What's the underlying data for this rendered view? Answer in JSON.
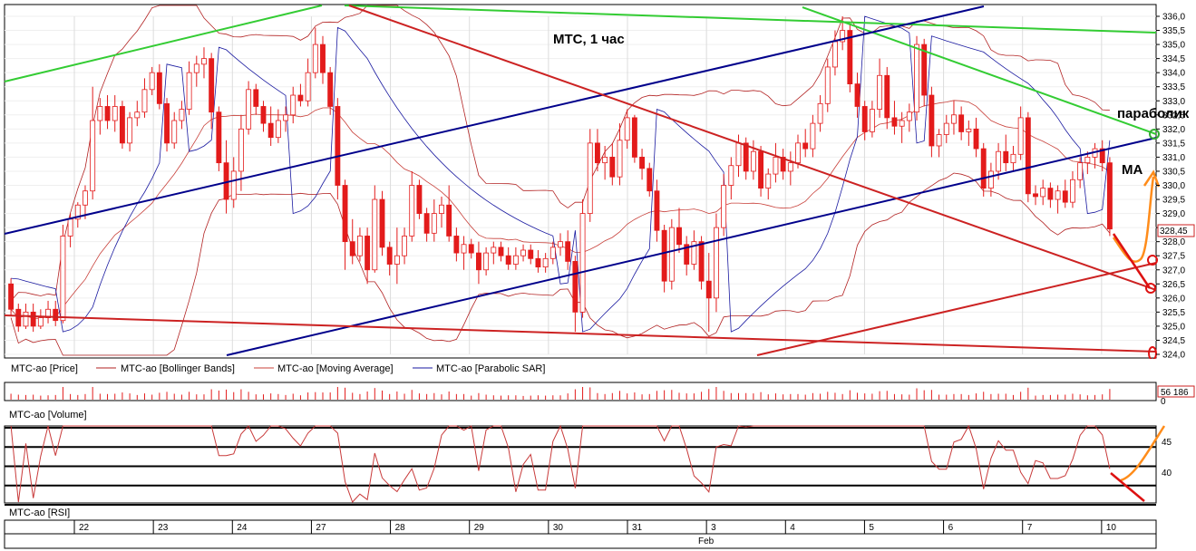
{
  "chart_data": [
    {
      "type": "candlestick",
      "title": "МТС,   1 час",
      "ylim": [
        324.0,
        336.0
      ],
      "ticks": [
        "336,0",
        "335,5",
        "335,0",
        "334,5",
        "334,0",
        "333,5",
        "333,0",
        "332,5",
        "332,0",
        "331,5",
        "331,0",
        "330,5",
        "330,0",
        "329,5",
        "329,0",
        "328,5",
        "328,0",
        "327,5",
        "327,0",
        "326,5",
        "326,0",
        "325,5",
        "325,0",
        "324,5",
        "324,0"
      ],
      "last_price_label": "328,45",
      "last_price": 328.45,
      "legend": [
        "MTC-ao [Price]",
        "MTC-ao [Bollinger Bands]",
        "MTC-ao [Moving Average]",
        "MTC-ao [Parabolic SAR]"
      ],
      "annotations": [
        "параболик",
        "MA"
      ],
      "candles": [
        {
          "o": 326.5,
          "h": 326.7,
          "l": 325.4,
          "c": 325.6
        },
        {
          "o": 325.6,
          "h": 325.8,
          "l": 324.8,
          "c": 325.0
        },
        {
          "o": 325.0,
          "h": 325.8,
          "l": 324.9,
          "c": 325.5
        },
        {
          "o": 325.5,
          "h": 325.8,
          "l": 324.8,
          "c": 325.0
        },
        {
          "o": 325.0,
          "h": 325.6,
          "l": 324.9,
          "c": 325.3
        },
        {
          "o": 325.3,
          "h": 325.9,
          "l": 325.1,
          "c": 325.6
        },
        {
          "o": 325.6,
          "h": 325.9,
          "l": 325.0,
          "c": 325.2
        },
        {
          "o": 325.2,
          "h": 328.6,
          "l": 325.1,
          "c": 328.2
        },
        {
          "o": 328.2,
          "h": 329.0,
          "l": 327.8,
          "c": 328.8
        },
        {
          "o": 328.8,
          "h": 329.4,
          "l": 328.5,
          "c": 329.3
        },
        {
          "o": 329.3,
          "h": 330.0,
          "l": 328.8,
          "c": 329.8
        },
        {
          "o": 329.8,
          "h": 333.5,
          "l": 329.5,
          "c": 332.3
        },
        {
          "o": 332.3,
          "h": 333.1,
          "l": 331.8,
          "c": 332.8
        },
        {
          "o": 332.8,
          "h": 333.2,
          "l": 332.0,
          "c": 332.3
        },
        {
          "o": 332.3,
          "h": 333.2,
          "l": 331.9,
          "c": 332.8
        },
        {
          "o": 332.8,
          "h": 333.0,
          "l": 331.3,
          "c": 331.5
        },
        {
          "o": 331.5,
          "h": 332.6,
          "l": 331.2,
          "c": 332.4
        },
        {
          "o": 332.4,
          "h": 333.0,
          "l": 332.1,
          "c": 332.6
        },
        {
          "o": 332.6,
          "h": 333.8,
          "l": 332.4,
          "c": 333.4
        },
        {
          "o": 333.4,
          "h": 334.2,
          "l": 333.2,
          "c": 334.0
        },
        {
          "o": 334.0,
          "h": 334.3,
          "l": 332.7,
          "c": 332.9
        },
        {
          "o": 332.9,
          "h": 333.1,
          "l": 331.2,
          "c": 331.5
        },
        {
          "o": 331.5,
          "h": 332.6,
          "l": 331.3,
          "c": 332.3
        },
        {
          "o": 332.3,
          "h": 333.0,
          "l": 332.0,
          "c": 332.7
        },
        {
          "o": 332.7,
          "h": 334.4,
          "l": 332.5,
          "c": 334.0
        },
        {
          "o": 334.0,
          "h": 334.6,
          "l": 333.5,
          "c": 334.3
        },
        {
          "o": 334.3,
          "h": 334.9,
          "l": 333.8,
          "c": 334.5
        },
        {
          "o": 334.5,
          "h": 334.7,
          "l": 332.0,
          "c": 332.6
        },
        {
          "o": 332.6,
          "h": 332.8,
          "l": 330.5,
          "c": 330.8
        },
        {
          "o": 330.8,
          "h": 331.6,
          "l": 329.0,
          "c": 329.5
        },
        {
          "o": 329.5,
          "h": 331.0,
          "l": 329.2,
          "c": 330.5
        },
        {
          "o": 330.5,
          "h": 332.5,
          "l": 329.8,
          "c": 332.0
        },
        {
          "o": 332.0,
          "h": 333.7,
          "l": 331.8,
          "c": 333.4
        },
        {
          "o": 333.4,
          "h": 333.6,
          "l": 332.5,
          "c": 332.8
        },
        {
          "o": 332.8,
          "h": 333.0,
          "l": 331.9,
          "c": 332.2
        },
        {
          "o": 332.2,
          "h": 332.8,
          "l": 331.4,
          "c": 331.7
        },
        {
          "o": 331.7,
          "h": 332.7,
          "l": 331.5,
          "c": 332.3
        },
        {
          "o": 332.3,
          "h": 332.8,
          "l": 331.9,
          "c": 332.5
        },
        {
          "o": 332.5,
          "h": 333.5,
          "l": 332.2,
          "c": 333.2
        },
        {
          "o": 333.2,
          "h": 333.6,
          "l": 332.8,
          "c": 333.0
        },
        {
          "o": 333.0,
          "h": 334.5,
          "l": 332.8,
          "c": 334.0
        },
        {
          "o": 334.0,
          "h": 335.6,
          "l": 333.8,
          "c": 335.0
        },
        {
          "o": 335.0,
          "h": 335.3,
          "l": 333.6,
          "c": 334.0
        },
        {
          "o": 334.0,
          "h": 334.2,
          "l": 332.5,
          "c": 332.8
        },
        {
          "o": 332.8,
          "h": 333.1,
          "l": 329.5,
          "c": 330.0
        },
        {
          "o": 330.0,
          "h": 330.2,
          "l": 327.0,
          "c": 328.0
        },
        {
          "o": 328.0,
          "h": 328.8,
          "l": 327.2,
          "c": 327.5
        },
        {
          "o": 327.5,
          "h": 328.5,
          "l": 327.3,
          "c": 328.2
        },
        {
          "o": 328.2,
          "h": 328.5,
          "l": 326.5,
          "c": 327.0
        },
        {
          "o": 327.0,
          "h": 330.0,
          "l": 326.9,
          "c": 329.5
        },
        {
          "o": 329.5,
          "h": 329.8,
          "l": 327.5,
          "c": 327.8
        },
        {
          "o": 327.8,
          "h": 328.0,
          "l": 326.8,
          "c": 327.2
        },
        {
          "o": 327.2,
          "h": 328.5,
          "l": 326.5,
          "c": 327.5
        },
        {
          "o": 327.5,
          "h": 328.5,
          "l": 327.2,
          "c": 328.2
        },
        {
          "o": 328.2,
          "h": 330.5,
          "l": 328.0,
          "c": 330.0
        },
        {
          "o": 330.0,
          "h": 330.2,
          "l": 328.8,
          "c": 329.0
        },
        {
          "o": 329.0,
          "h": 329.2,
          "l": 328.0,
          "c": 328.3
        },
        {
          "o": 328.3,
          "h": 329.5,
          "l": 328.0,
          "c": 329.0
        },
        {
          "o": 329.0,
          "h": 329.6,
          "l": 328.5,
          "c": 329.3
        },
        {
          "o": 329.3,
          "h": 330.0,
          "l": 328.0,
          "c": 328.2
        },
        {
          "o": 328.2,
          "h": 328.5,
          "l": 327.3,
          "c": 327.6
        },
        {
          "o": 327.6,
          "h": 328.2,
          "l": 327.0,
          "c": 327.9
        },
        {
          "o": 327.9,
          "h": 328.1,
          "l": 327.4,
          "c": 327.6
        },
        {
          "o": 327.6,
          "h": 328.0,
          "l": 326.5,
          "c": 327.0
        },
        {
          "o": 327.0,
          "h": 327.8,
          "l": 326.8,
          "c": 327.6
        },
        {
          "o": 327.6,
          "h": 328.0,
          "l": 327.2,
          "c": 327.8
        },
        {
          "o": 327.8,
          "h": 328.0,
          "l": 327.3,
          "c": 327.5
        },
        {
          "o": 327.5,
          "h": 327.8,
          "l": 327.0,
          "c": 327.2
        },
        {
          "o": 327.2,
          "h": 327.8,
          "l": 327.0,
          "c": 327.5
        },
        {
          "o": 327.5,
          "h": 327.9,
          "l": 327.3,
          "c": 327.7
        },
        {
          "o": 327.7,
          "h": 327.9,
          "l": 327.2,
          "c": 327.4
        },
        {
          "o": 327.4,
          "h": 327.7,
          "l": 326.9,
          "c": 327.1
        },
        {
          "o": 327.1,
          "h": 327.6,
          "l": 326.9,
          "c": 327.4
        },
        {
          "o": 327.4,
          "h": 328.0,
          "l": 327.2,
          "c": 327.8
        },
        {
          "o": 327.8,
          "h": 328.3,
          "l": 327.5,
          "c": 328.0
        },
        {
          "o": 328.0,
          "h": 328.4,
          "l": 327.0,
          "c": 327.3
        },
        {
          "o": 327.3,
          "h": 327.5,
          "l": 324.8,
          "c": 325.5
        },
        {
          "o": 325.5,
          "h": 329.5,
          "l": 325.3,
          "c": 329.0
        },
        {
          "o": 329.0,
          "h": 332.0,
          "l": 328.7,
          "c": 331.5
        },
        {
          "o": 331.5,
          "h": 332.0,
          "l": 330.5,
          "c": 330.8
        },
        {
          "o": 330.8,
          "h": 331.4,
          "l": 330.2,
          "c": 331.0
        },
        {
          "o": 331.0,
          "h": 331.5,
          "l": 330.0,
          "c": 330.3
        },
        {
          "o": 330.3,
          "h": 332.2,
          "l": 330.0,
          "c": 331.6
        },
        {
          "o": 331.6,
          "h": 332.7,
          "l": 331.3,
          "c": 332.4
        },
        {
          "o": 332.4,
          "h": 332.5,
          "l": 330.8,
          "c": 331.0
        },
        {
          "o": 331.0,
          "h": 331.3,
          "l": 330.2,
          "c": 330.6
        },
        {
          "o": 330.6,
          "h": 330.8,
          "l": 329.6,
          "c": 329.8
        },
        {
          "o": 329.8,
          "h": 330.2,
          "l": 328.0,
          "c": 328.4
        },
        {
          "o": 328.4,
          "h": 328.6,
          "l": 326.2,
          "c": 326.6
        },
        {
          "o": 326.6,
          "h": 328.8,
          "l": 326.3,
          "c": 328.5
        },
        {
          "o": 328.5,
          "h": 329.2,
          "l": 327.6,
          "c": 327.9
        },
        {
          "o": 327.9,
          "h": 328.2,
          "l": 326.8,
          "c": 327.2
        },
        {
          "o": 327.2,
          "h": 328.4,
          "l": 327.0,
          "c": 328.0
        },
        {
          "o": 328.0,
          "h": 328.2,
          "l": 326.3,
          "c": 326.6
        },
        {
          "o": 326.6,
          "h": 327.6,
          "l": 324.8,
          "c": 326.0
        },
        {
          "o": 326.0,
          "h": 329.0,
          "l": 325.5,
          "c": 328.5
        },
        {
          "o": 328.5,
          "h": 330.4,
          "l": 328.2,
          "c": 330.0
        },
        {
          "o": 330.0,
          "h": 331.0,
          "l": 329.5,
          "c": 330.7
        },
        {
          "o": 330.7,
          "h": 331.8,
          "l": 330.3,
          "c": 331.5
        },
        {
          "o": 331.5,
          "h": 331.7,
          "l": 330.2,
          "c": 330.5
        },
        {
          "o": 330.5,
          "h": 331.6,
          "l": 330.2,
          "c": 331.2
        },
        {
          "o": 331.2,
          "h": 331.4,
          "l": 329.6,
          "c": 329.9
        },
        {
          "o": 329.9,
          "h": 330.6,
          "l": 329.5,
          "c": 330.4
        },
        {
          "o": 330.4,
          "h": 331.5,
          "l": 330.1,
          "c": 331.0
        },
        {
          "o": 331.0,
          "h": 331.3,
          "l": 330.2,
          "c": 330.5
        },
        {
          "o": 330.5,
          "h": 331.2,
          "l": 330.0,
          "c": 330.8
        },
        {
          "o": 330.8,
          "h": 331.8,
          "l": 330.6,
          "c": 331.5
        },
        {
          "o": 331.5,
          "h": 332.0,
          "l": 331.0,
          "c": 331.3
        },
        {
          "o": 331.3,
          "h": 332.5,
          "l": 331.0,
          "c": 332.2
        },
        {
          "o": 332.2,
          "h": 333.2,
          "l": 331.9,
          "c": 332.9
        },
        {
          "o": 332.9,
          "h": 334.5,
          "l": 332.6,
          "c": 334.2
        },
        {
          "o": 334.2,
          "h": 335.5,
          "l": 333.9,
          "c": 335.1
        },
        {
          "o": 335.1,
          "h": 336.0,
          "l": 334.8,
          "c": 335.5
        },
        {
          "o": 335.5,
          "h": 335.7,
          "l": 333.3,
          "c": 333.6
        },
        {
          "o": 333.6,
          "h": 334.0,
          "l": 332.4,
          "c": 332.8
        },
        {
          "o": 332.8,
          "h": 333.0,
          "l": 331.6,
          "c": 331.9
        },
        {
          "o": 331.9,
          "h": 333.0,
          "l": 331.7,
          "c": 332.7
        },
        {
          "o": 332.7,
          "h": 334.5,
          "l": 332.4,
          "c": 333.9
        },
        {
          "o": 333.9,
          "h": 334.2,
          "l": 332.0,
          "c": 332.4
        },
        {
          "o": 332.4,
          "h": 333.0,
          "l": 331.8,
          "c": 332.1
        },
        {
          "o": 332.1,
          "h": 332.6,
          "l": 331.5,
          "c": 332.3
        },
        {
          "o": 332.3,
          "h": 332.9,
          "l": 331.9,
          "c": 332.6
        },
        {
          "o": 332.6,
          "h": 335.3,
          "l": 332.3,
          "c": 335.0
        },
        {
          "o": 335.0,
          "h": 335.2,
          "l": 332.8,
          "c": 333.2
        },
        {
          "o": 333.2,
          "h": 333.5,
          "l": 331.0,
          "c": 331.4
        },
        {
          "o": 331.4,
          "h": 332.0,
          "l": 331.0,
          "c": 331.8
        },
        {
          "o": 331.8,
          "h": 332.5,
          "l": 331.5,
          "c": 332.2
        },
        {
          "o": 332.2,
          "h": 333.0,
          "l": 331.8,
          "c": 332.5
        },
        {
          "o": 332.5,
          "h": 332.8,
          "l": 331.6,
          "c": 331.9
        },
        {
          "o": 331.9,
          "h": 332.3,
          "l": 331.4,
          "c": 332.0
        },
        {
          "o": 332.0,
          "h": 332.4,
          "l": 331.0,
          "c": 331.3
        },
        {
          "o": 331.3,
          "h": 331.5,
          "l": 329.6,
          "c": 329.9
        },
        {
          "o": 329.9,
          "h": 330.8,
          "l": 329.6,
          "c": 330.5
        },
        {
          "o": 330.5,
          "h": 331.5,
          "l": 330.2,
          "c": 331.2
        },
        {
          "o": 331.2,
          "h": 331.8,
          "l": 330.5,
          "c": 330.8
        },
        {
          "o": 330.8,
          "h": 331.4,
          "l": 330.5,
          "c": 331.1
        },
        {
          "o": 331.1,
          "h": 332.8,
          "l": 330.9,
          "c": 332.4
        },
        {
          "o": 332.4,
          "h": 332.6,
          "l": 329.4,
          "c": 329.7
        },
        {
          "o": 329.7,
          "h": 330.0,
          "l": 329.3,
          "c": 329.6
        },
        {
          "o": 329.6,
          "h": 330.2,
          "l": 329.3,
          "c": 329.9
        },
        {
          "o": 329.9,
          "h": 330.1,
          "l": 329.2,
          "c": 329.5
        },
        {
          "o": 329.5,
          "h": 330.0,
          "l": 329.0,
          "c": 329.8
        },
        {
          "o": 329.8,
          "h": 330.2,
          "l": 329.2,
          "c": 329.4
        },
        {
          "o": 329.4,
          "h": 330.5,
          "l": 329.2,
          "c": 330.2
        },
        {
          "o": 330.2,
          "h": 331.0,
          "l": 329.9,
          "c": 330.8
        },
        {
          "o": 330.8,
          "h": 331.2,
          "l": 330.4,
          "c": 331.0
        },
        {
          "o": 331.0,
          "h": 331.5,
          "l": 330.6,
          "c": 331.3
        },
        {
          "o": 331.3,
          "h": 331.6,
          "l": 330.5,
          "c": 330.8
        },
        {
          "o": 330.8,
          "h": 331.0,
          "l": 328.2,
          "c": 328.45
        }
      ]
    },
    {
      "type": "bar",
      "title": "MTC-ao [Volume]",
      "last_value_label": "56 186",
      "tick_zero": "0"
    },
    {
      "type": "line",
      "title": "MTC-ao [RSI]",
      "ticks": [
        "45",
        "40"
      ],
      "levels": [
        30,
        35,
        40,
        45,
        50
      ]
    }
  ],
  "x_axis": {
    "days": [
      "22",
      "23",
      "24",
      "27",
      "28",
      "29",
      "30",
      "31",
      "3",
      "4",
      "5",
      "6",
      "7",
      "10"
    ],
    "month_label": "Feb"
  },
  "colors": {
    "candle": "#e31b1b",
    "bollinger": "#b22222",
    "moving_average": "#c8403a",
    "sar": "#1a1aa0",
    "channel_blue": "#00008b",
    "trend_green": "#33cc33",
    "trend_red": "#cc2222",
    "forecast": "#ff8c1a"
  }
}
